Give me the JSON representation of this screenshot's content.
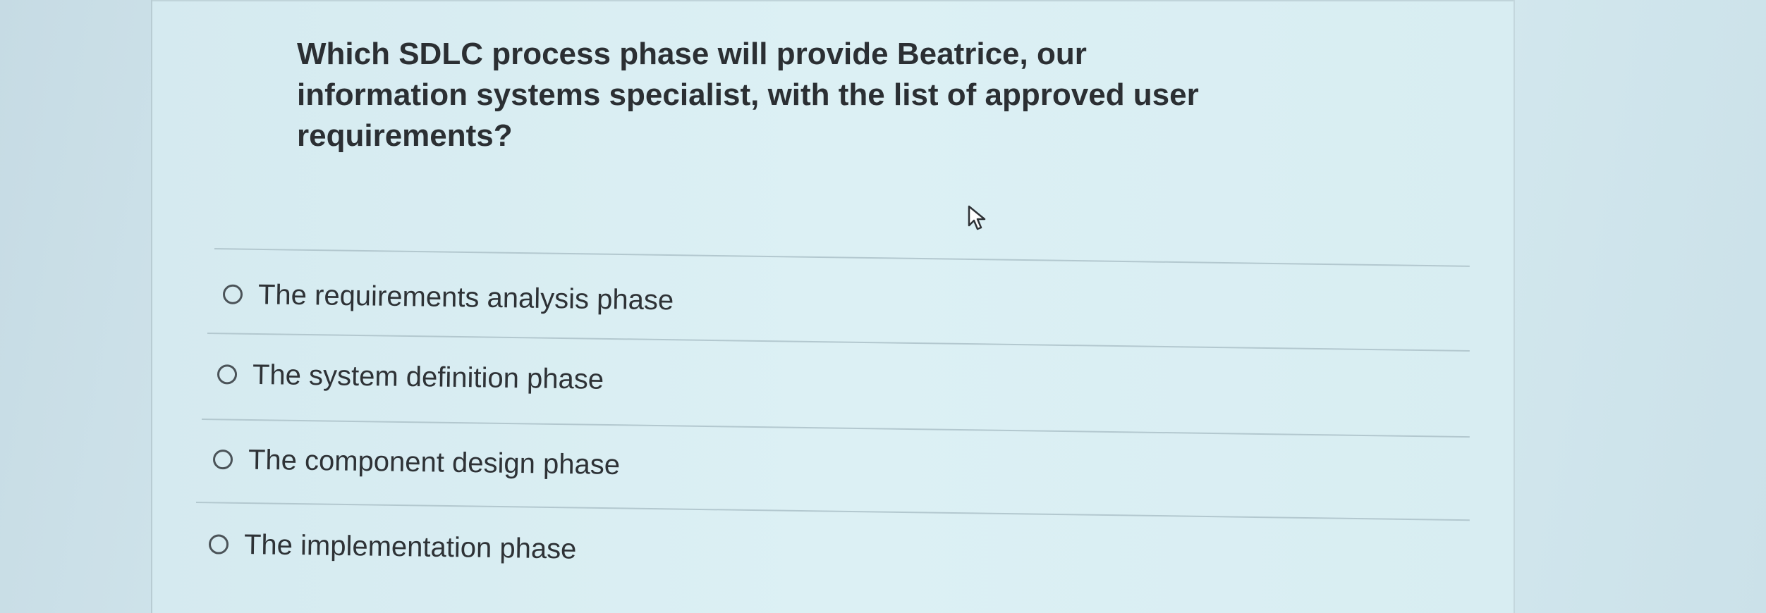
{
  "question": {
    "text": "Which SDLC process phase will provide Beatrice, our information systems specialist, with the list of approved user requirements?"
  },
  "options": [
    {
      "label": "The requirements analysis phase",
      "selected": false
    },
    {
      "label": "The system definition phase",
      "selected": false
    },
    {
      "label": "The component design phase",
      "selected": false
    },
    {
      "label": "The implementation phase",
      "selected": false
    }
  ],
  "cursor": {
    "icon": "mouse-pointer-icon"
  }
}
